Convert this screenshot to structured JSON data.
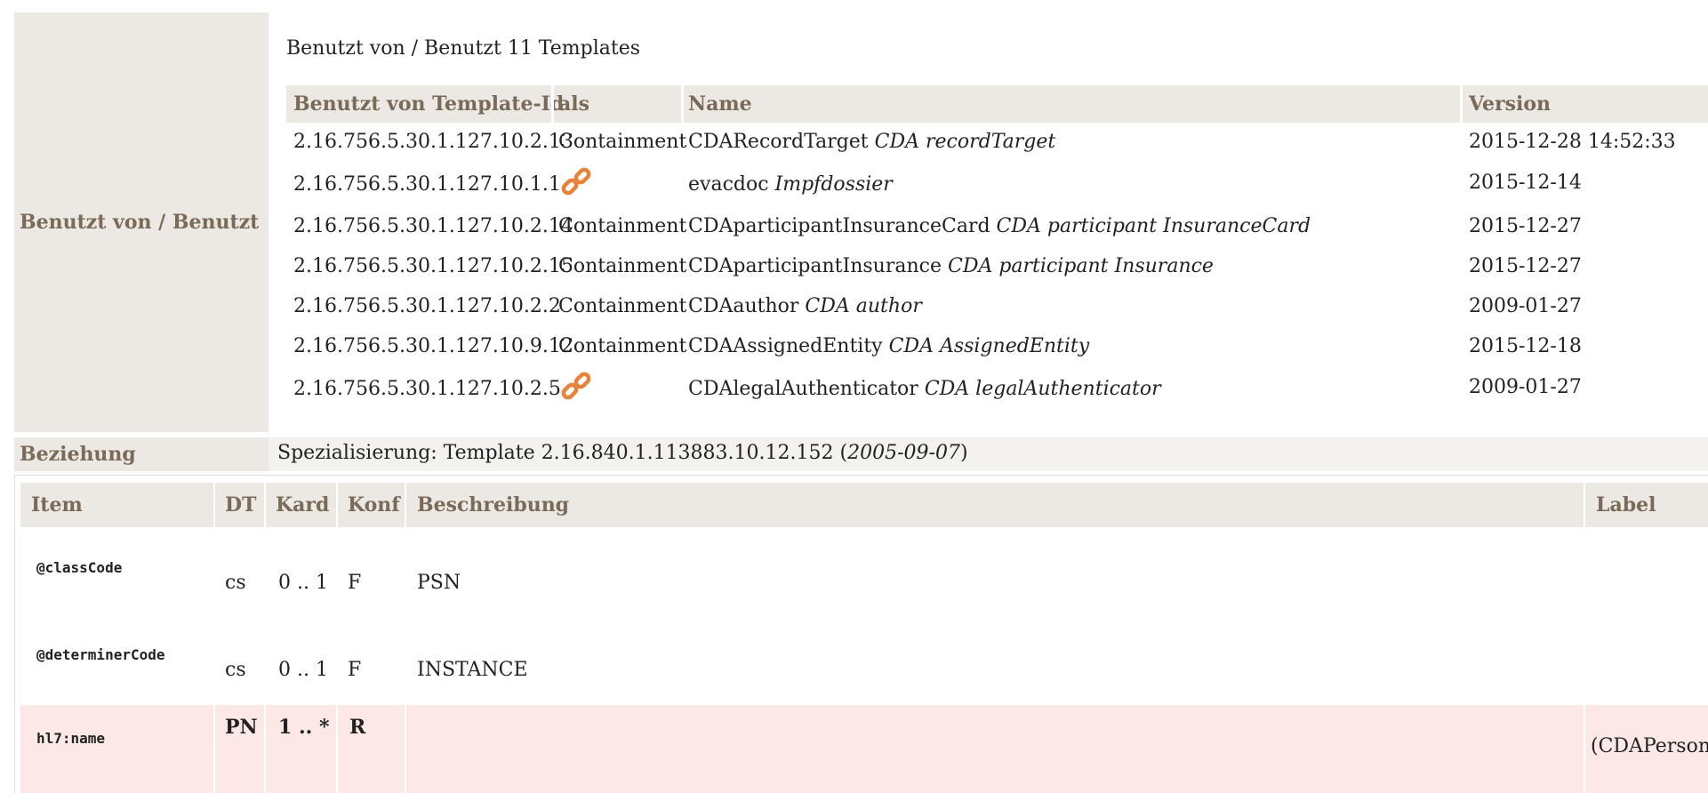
{
  "used_section": {
    "label": "Benutzt von / Benutzt",
    "title": "Benutzt von / Benutzt 11 Templates",
    "headers": {
      "template_id": "Benutzt von Template-Id",
      "als": "als",
      "name": "Name",
      "version": "Version"
    },
    "rows": [
      {
        "id": "2.16.756.5.30.1.127.10.2.13",
        "als": "Containment",
        "name": "CDARecordTarget",
        "name_italic": "CDA recordTarget",
        "version": "2015-12-28 14:52:33"
      },
      {
        "id": "2.16.756.5.30.1.127.10.1.1",
        "als": "",
        "icon": "link-icon",
        "name": "evacdoc",
        "name_italic": "Impfdossier",
        "version": "2015-12-14"
      },
      {
        "id": "2.16.756.5.30.1.127.10.2.14",
        "als": "Containment",
        "name": "CDAparticipantInsuranceCard",
        "name_italic": "CDA participant InsuranceCard",
        "version": "2015-12-27"
      },
      {
        "id": "2.16.756.5.30.1.127.10.2.15",
        "als": "Containment",
        "name": "CDAparticipantInsurance",
        "name_italic": "CDA participant Insurance",
        "version": "2015-12-27"
      },
      {
        "id": "2.16.756.5.30.1.127.10.2.2",
        "als": "Containment",
        "name": "CDAauthor",
        "name_italic": "CDA author",
        "version": "2009-01-27"
      },
      {
        "id": "2.16.756.5.30.1.127.10.9.12",
        "als": "Containment",
        "name": "CDAAssignedEntity",
        "name_italic": "CDA AssignedEntity",
        "version": "2015-12-18"
      },
      {
        "id": "2.16.756.5.30.1.127.10.2.5",
        "als": "",
        "icon": "link-icon",
        "name": "CDAlegalAuthenticator",
        "name_italic": "CDA legalAuthenticator",
        "version": "2009-01-27"
      }
    ],
    "icon_color": "#e8843a"
  },
  "relation": {
    "label": "Beziehung",
    "prefix": "Spezialisierung: Template 2.16.840.1.113883.10.12.152 (",
    "date": "2005-09-07",
    "suffix": ")"
  },
  "items_table": {
    "headers": {
      "item": "Item",
      "dt": "DT",
      "kard": "Kard",
      "konf": "Konf",
      "beschreibung": "Beschreibung",
      "label": "Label"
    },
    "rows": [
      {
        "item": "@classCode",
        "dt": "cs",
        "kard": "0 .. 1",
        "konf": "F",
        "beschreibung": "PSN",
        "label": ""
      },
      {
        "item": "@determinerCode",
        "dt": "cs",
        "kard": "0 .. 1",
        "konf": "F",
        "beschreibung": "INSTANCE",
        "label": ""
      },
      {
        "item": "hl7:name",
        "dt": "PN",
        "kard": "1 .. *",
        "konf": "R",
        "beschreibung": "",
        "label": "(CDAPerson)"
      }
    ],
    "highlight_color": "#fde8e8"
  }
}
